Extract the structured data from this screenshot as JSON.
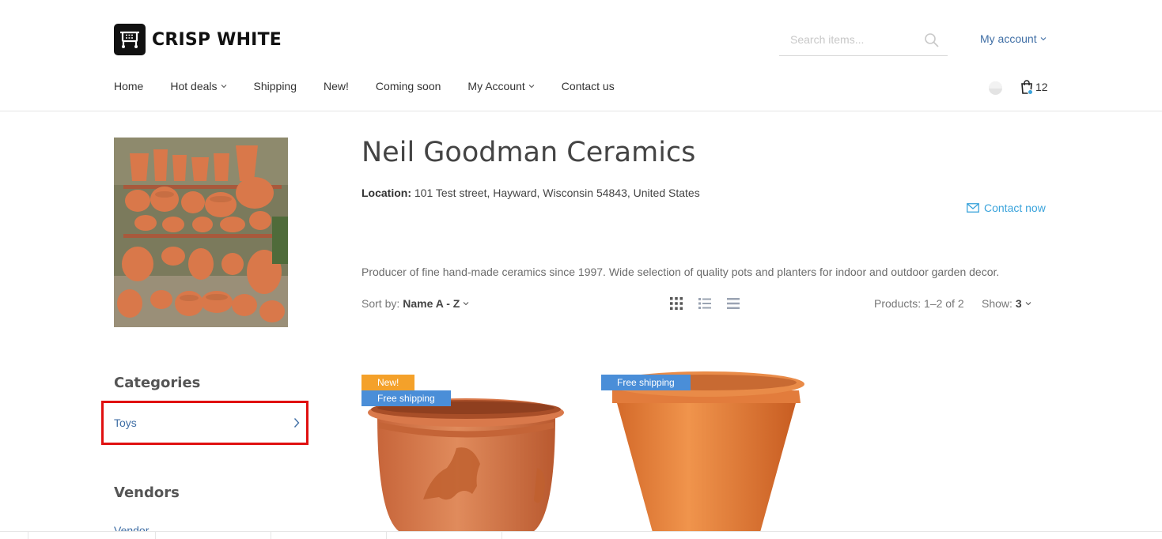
{
  "brand": {
    "name": "CRISP WHITE",
    "logo_icon": "cart-logo-icon"
  },
  "search": {
    "placeholder": "Search items..."
  },
  "account_menu": {
    "label": "My account"
  },
  "nav": {
    "items": [
      {
        "label": "Home",
        "has_dropdown": false
      },
      {
        "label": "Hot deals",
        "has_dropdown": true
      },
      {
        "label": "Shipping",
        "has_dropdown": false
      },
      {
        "label": "New!",
        "has_dropdown": false
      },
      {
        "label": "Coming soon",
        "has_dropdown": false
      },
      {
        "label": "My Account",
        "has_dropdown": true
      },
      {
        "label": "Contact us",
        "has_dropdown": false
      }
    ]
  },
  "cart": {
    "count": "12"
  },
  "vendor": {
    "name": "Neil Goodman Ceramics",
    "location_label": "Location:",
    "location_value": "101 Test street, Hayward, Wisconsin 54843, United States",
    "contact_label": "Contact now",
    "description": "Producer of fine hand-made ceramics since 1997. Wide selection of quality pots and planters for indoor and outdoor garden decor."
  },
  "toolbar": {
    "sort_label": "Sort by:",
    "sort_value": "Name A - Z",
    "products_count": "Products: 1–2 of 2",
    "show_label": "Show:",
    "show_value": "3"
  },
  "sidebar": {
    "categories_heading": "Categories",
    "categories": [
      {
        "label": "Toys"
      }
    ],
    "vendors_heading": "Vendors",
    "vendor_link": "Vendor"
  },
  "products": [
    {
      "badges": [
        "New!",
        "Free shipping"
      ]
    },
    {
      "badges": [
        "Free shipping"
      ]
    }
  ],
  "colors": {
    "accent_link": "#3f6ea5",
    "contact_link": "#3aa3db",
    "badge_new": "#f4a12a",
    "badge_shipping": "#4a8ed8",
    "highlight_border": "#e01010",
    "terracotta": "#d9784a"
  }
}
